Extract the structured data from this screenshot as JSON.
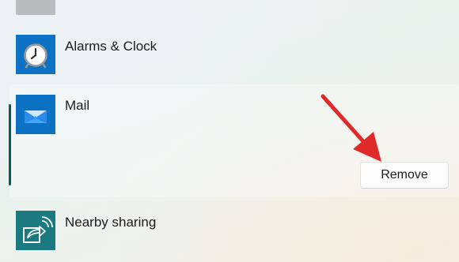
{
  "apps": [
    {
      "name": "",
      "icon": "app-icon-partial"
    },
    {
      "name": "Alarms & Clock",
      "icon": "alarm-clock-icon"
    },
    {
      "name": "Mail",
      "icon": "mail-envelope-icon",
      "expanded": true,
      "action_label": "Remove"
    },
    {
      "name": "Nearby sharing",
      "icon": "nearby-sharing-icon"
    }
  ],
  "colors": {
    "app_icon_blue": "#0d72c4",
    "nearby_icon_teal": "#1b7a80",
    "selection_bar": "#0f5560",
    "annotation_arrow": "#e02a2a"
  }
}
